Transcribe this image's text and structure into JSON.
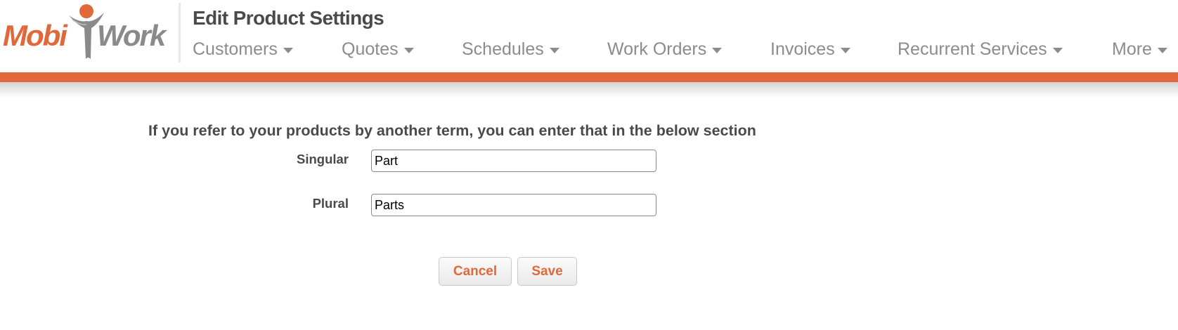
{
  "brand": {
    "logo_text_left": "Mobi",
    "logo_text_right": "Work",
    "accent_color": "#e0683b",
    "logo_gray": "#8a8a8a"
  },
  "header": {
    "title": "Edit Product Settings"
  },
  "nav": {
    "items": [
      {
        "label": "Customers",
        "icon": "caret-down-icon"
      },
      {
        "label": "Quotes",
        "icon": "caret-down-icon"
      },
      {
        "label": "Schedules",
        "icon": "caret-down-icon"
      },
      {
        "label": "Work Orders",
        "icon": "caret-down-icon"
      },
      {
        "label": "Invoices",
        "icon": "caret-down-icon"
      },
      {
        "label": "Recurrent Services",
        "icon": "caret-down-icon"
      },
      {
        "label": "More",
        "icon": "caret-down-icon"
      }
    ]
  },
  "form": {
    "intro": "If you refer to your products by another term, you can enter that in the below section",
    "singular": {
      "label": "Singular",
      "value": "Part"
    },
    "plural": {
      "label": "Plural",
      "value": "Parts"
    },
    "cancel_label": "Cancel",
    "save_label": "Save"
  }
}
